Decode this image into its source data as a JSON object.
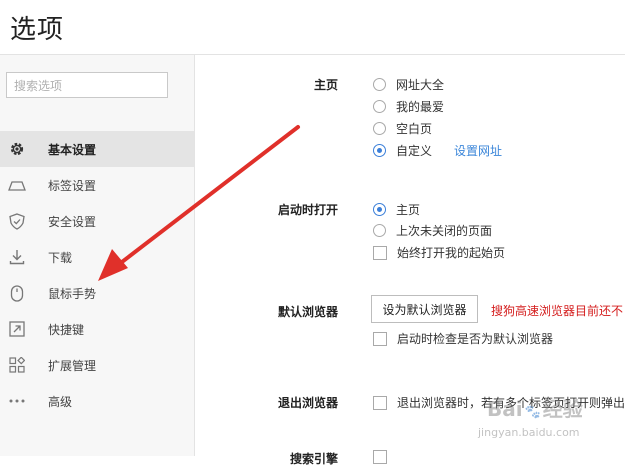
{
  "window": {
    "title": "选项"
  },
  "search": {
    "placeholder": "搜索选项"
  },
  "sidebar": {
    "items": [
      {
        "label": "基本设置",
        "icon": "gear-icon"
      },
      {
        "label": "标签设置",
        "icon": "tab-icon"
      },
      {
        "label": "安全设置",
        "icon": "shield-icon"
      },
      {
        "label": "下载",
        "icon": "download-icon"
      },
      {
        "label": "鼠标手势",
        "icon": "mouse-icon"
      },
      {
        "label": "快捷键",
        "icon": "shortcut-icon"
      },
      {
        "label": "扩展管理",
        "icon": "extensions-icon"
      },
      {
        "label": "高级",
        "icon": "more-icon"
      }
    ],
    "active": "基本设置"
  },
  "homepage": {
    "label": "主页",
    "options": [
      "网址大全",
      "我的最爱",
      "空白页",
      "自定义"
    ],
    "selected": "自定义",
    "link": "设置网址"
  },
  "startup": {
    "label": "启动时打开",
    "options": [
      "主页",
      "上次未关闭的页面"
    ],
    "selected": "主页",
    "checkbox": "始终打开我的起始页"
  },
  "default_browser": {
    "label": "默认浏览器",
    "button": "设为默认浏览器",
    "warning": "搜狗高速浏览器目前还不",
    "checkbox": "启动时检查是否为默认浏览器"
  },
  "exit": {
    "label": "退出浏览器",
    "checkbox": "退出浏览器时，若有多个标签页打开则弹出"
  },
  "partial_section": {
    "label": "搜索引擎"
  },
  "watermark": {
    "brand": "Bai",
    "text": "经验",
    "url": "jingyan.baidu.com"
  },
  "colors": {
    "accent": "#3b7fd9",
    "link": "#3b86d9",
    "warning": "#d41c1c",
    "arrow": "#e0302a"
  }
}
